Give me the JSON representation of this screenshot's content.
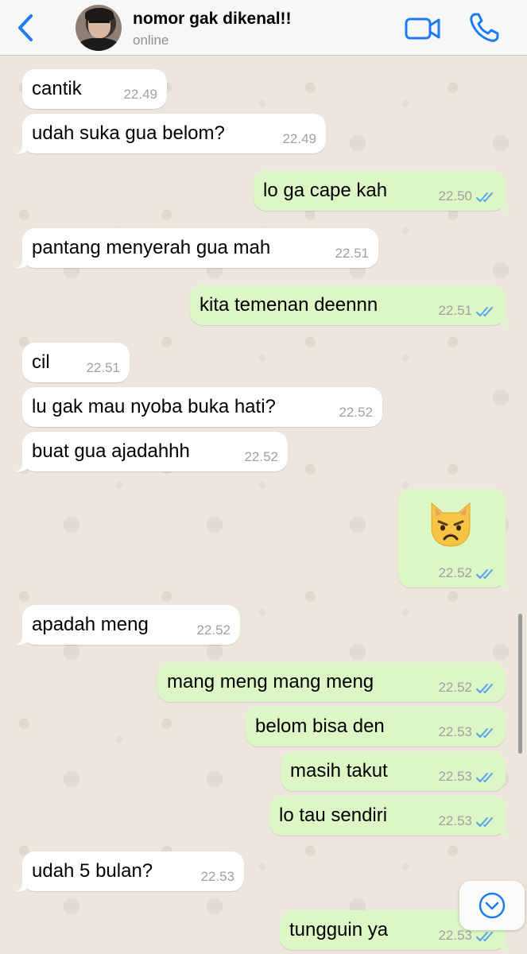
{
  "header": {
    "contact_name": "nomor gak dikenal!!",
    "status": "online"
  },
  "messages": [
    {
      "side": "in",
      "text": "cantik",
      "time": "22.49"
    },
    {
      "side": "in",
      "text": "udah suka gua belom?",
      "time": "22.49"
    },
    {
      "side": "out",
      "text": "lo ga cape kah",
      "time": "22.50"
    },
    {
      "side": "in",
      "text": "pantang menyerah gua mah",
      "time": "22.51"
    },
    {
      "side": "out",
      "text": "kita temenan deennn",
      "time": "22.51"
    },
    {
      "side": "in",
      "text": "cil",
      "time": "22.51"
    },
    {
      "side": "in",
      "text": "lu gak mau nyoba buka hati?",
      "time": "22.52"
    },
    {
      "side": "in",
      "text": "buat gua ajadahhh",
      "time": "22.52"
    },
    {
      "side": "out",
      "emoji": "pouting-cat-face",
      "time": "22.52"
    },
    {
      "side": "in",
      "text": "apadah meng",
      "time": "22.52"
    },
    {
      "side": "out",
      "text": "mang meng mang meng",
      "time": "22.52"
    },
    {
      "side": "out",
      "text": "belom bisa den",
      "time": "22.53"
    },
    {
      "side": "out",
      "text": "masih takut",
      "time": "22.53"
    },
    {
      "side": "out",
      "text": "lo tau sendiri",
      "time": "22.53"
    },
    {
      "side": "in",
      "text": "udah 5 bulan?",
      "time": "22.53"
    },
    {
      "side": "out",
      "text": "tungguin ya",
      "time": "22.53"
    }
  ],
  "colors": {
    "accent": "#1b7cf2",
    "incoming_bubble": "#ffffff",
    "outgoing_bubble": "#dcf7c5",
    "read_ticks": "#4fa3f7",
    "chat_background": "#ece6dc"
  },
  "icons": [
    "back-chevron-icon",
    "video-call-icon",
    "voice-call-icon",
    "double-check-icon",
    "scroll-down-icon"
  ]
}
